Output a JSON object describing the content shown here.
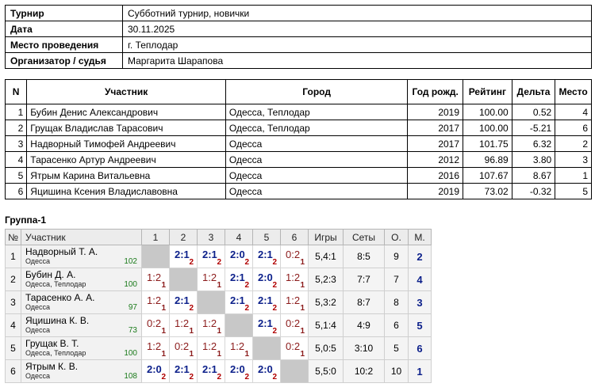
{
  "info": [
    {
      "label": "Турнир",
      "value": "Субботний турнир, новички"
    },
    {
      "label": "Дата",
      "value": "30.11.2025"
    },
    {
      "label": "Место проведения",
      "value": "г. Теплодар"
    },
    {
      "label": "Организатор / судья",
      "value": "Маргарита Шарапова"
    }
  ],
  "participants": {
    "headers": [
      "N",
      "Участник",
      "Город",
      "Год рожд.",
      "Рейтинг",
      "Дельта",
      "Место"
    ],
    "rows": [
      {
        "n": "1",
        "name": "Бубин Денис Александрович",
        "city": "Одесса, Теплодар",
        "year": "2019",
        "rating": "100.00",
        "delta": "0.52",
        "place": "4"
      },
      {
        "n": "2",
        "name": "Грущак Владислав Тарасович",
        "city": "Одесса, Теплодар",
        "year": "2017",
        "rating": "100.00",
        "delta": "-5.21",
        "place": "6"
      },
      {
        "n": "3",
        "name": "Надворный Тимофей Андреевич",
        "city": "Одесса",
        "year": "2017",
        "rating": "101.75",
        "delta": "6.32",
        "place": "2"
      },
      {
        "n": "4",
        "name": "Тарасенко Артур Андреевич",
        "city": "Одесса",
        "year": "2012",
        "rating": "96.89",
        "delta": "3.80",
        "place": "3"
      },
      {
        "n": "5",
        "name": "Ятрым Карина Витальевна",
        "city": "Одесса",
        "year": "2016",
        "rating": "107.67",
        "delta": "8.67",
        "place": "1"
      },
      {
        "n": "6",
        "name": "Яцишина Ксения Владиславовна",
        "city": "Одесса",
        "year": "2019",
        "rating": "73.02",
        "delta": "-0.32",
        "place": "5"
      }
    ]
  },
  "group": {
    "title": "Группа-1",
    "headers": [
      "№",
      "Участник",
      "1",
      "2",
      "3",
      "4",
      "5",
      "6",
      "Игры",
      "Сеты",
      "О.",
      "М."
    ],
    "rows": [
      {
        "no": "1",
        "name": "Надворный Т. А.",
        "city": "Одесса",
        "rating": "102",
        "results": [
          null,
          {
            "s": "2:1",
            "sub": "2",
            "win": true
          },
          {
            "s": "2:1",
            "sub": "2",
            "win": true
          },
          {
            "s": "2:0",
            "sub": "2",
            "win": true
          },
          {
            "s": "2:1",
            "sub": "2",
            "win": true
          },
          {
            "s": "0:2",
            "sub": "1",
            "win": false
          }
        ],
        "games": "5,4:1",
        "sets": "8:5",
        "points": "9",
        "place": "2"
      },
      {
        "no": "2",
        "name": "Бубин Д. А.",
        "city": "Одесса, Теплодар",
        "rating": "100",
        "results": [
          {
            "s": "1:2",
            "sub": "1",
            "win": false
          },
          null,
          {
            "s": "1:2",
            "sub": "1",
            "win": false
          },
          {
            "s": "2:1",
            "sub": "2",
            "win": true
          },
          {
            "s": "2:0",
            "sub": "2",
            "win": true
          },
          {
            "s": "1:2",
            "sub": "1",
            "win": false
          }
        ],
        "games": "5,2:3",
        "sets": "7:7",
        "points": "7",
        "place": "4"
      },
      {
        "no": "3",
        "name": "Тарасенко А. А.",
        "city": "Одесса",
        "rating": "97",
        "results": [
          {
            "s": "1:2",
            "sub": "1",
            "win": false
          },
          {
            "s": "2:1",
            "sub": "2",
            "win": true
          },
          null,
          {
            "s": "2:1",
            "sub": "2",
            "win": true
          },
          {
            "s": "2:1",
            "sub": "2",
            "win": true
          },
          {
            "s": "1:2",
            "sub": "1",
            "win": false
          }
        ],
        "games": "5,3:2",
        "sets": "8:7",
        "points": "8",
        "place": "3"
      },
      {
        "no": "4",
        "name": "Яцишина К. В.",
        "city": "Одесса",
        "rating": "73",
        "results": [
          {
            "s": "0:2",
            "sub": "1",
            "win": false
          },
          {
            "s": "1:2",
            "sub": "1",
            "win": false
          },
          {
            "s": "1:2",
            "sub": "1",
            "win": false
          },
          null,
          {
            "s": "2:1",
            "sub": "2",
            "win": true
          },
          {
            "s": "0:2",
            "sub": "1",
            "win": false
          }
        ],
        "games": "5,1:4",
        "sets": "4:9",
        "points": "6",
        "place": "5"
      },
      {
        "no": "5",
        "name": "Грущак В. Т.",
        "city": "Одесса, Теплодар",
        "rating": "100",
        "results": [
          {
            "s": "1:2",
            "sub": "1",
            "win": false
          },
          {
            "s": "0:2",
            "sub": "1",
            "win": false
          },
          {
            "s": "1:2",
            "sub": "1",
            "win": false
          },
          {
            "s": "1:2",
            "sub": "1",
            "win": false
          },
          null,
          {
            "s": "0:2",
            "sub": "1",
            "win": false
          }
        ],
        "games": "5,0:5",
        "sets": "3:10",
        "points": "5",
        "place": "6"
      },
      {
        "no": "6",
        "name": "Ятрым К. В.",
        "city": "Одесса",
        "rating": "108",
        "results": [
          {
            "s": "2:0",
            "sub": "2",
            "win": true
          },
          {
            "s": "2:1",
            "sub": "2",
            "win": true
          },
          {
            "s": "2:1",
            "sub": "2",
            "win": true
          },
          {
            "s": "2:0",
            "sub": "2",
            "win": true
          },
          {
            "s": "2:0",
            "sub": "2",
            "win": true
          },
          null
        ],
        "games": "5,5:0",
        "sets": "10:2",
        "points": "10",
        "place": "1"
      }
    ]
  }
}
